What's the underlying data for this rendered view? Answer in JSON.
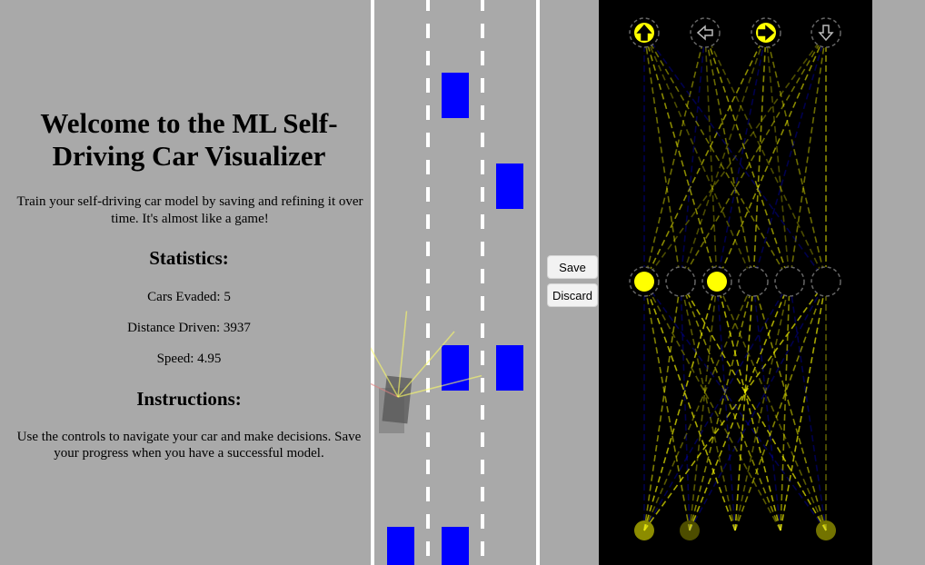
{
  "info": {
    "title": "Welcome to the ML Self-Driving Car Visualizer",
    "intro": "Train your self-driving car model by saving and refining it over time. It's almost like a game!",
    "statistics_heading": "Statistics:",
    "cars_evaded": "Cars Evaded: 5",
    "distance_driven": "Distance Driven: 3937",
    "speed": "Speed: 4.95",
    "instructions_heading": "Instructions:",
    "instructions_text": "Use the controls to navigate your car and make decisions. Save your progress when you have a successful model."
  },
  "controls": {
    "save_label": "Save",
    "discard_label": "Discard"
  },
  "colors": {
    "page_background": "#a9a9a9",
    "road_surface": "#a9a9a9",
    "road_lines": "#ffffff",
    "traffic_car": "#0000ff",
    "player_car": "#555555",
    "sensor_ray": "#ffff66",
    "sensor_hit": "#e08080",
    "network_background": "#000000",
    "node_active": "#ffff00",
    "weight_positive": "#ffff00",
    "weight_negative": "#0000ff"
  },
  "road": {
    "lanes": 3,
    "traffic_cars": [
      {
        "lane": 1,
        "row": 0
      },
      {
        "lane": 2,
        "row": 1
      },
      {
        "lane": 1,
        "row": 2
      },
      {
        "lane": 2,
        "row": 2
      },
      {
        "lane": 0,
        "row": 3
      },
      {
        "lane": 1,
        "row": 3
      }
    ],
    "player": {
      "lane": 0,
      "sensor_rays": 5
    }
  },
  "network": {
    "output_icons": [
      "arrow-up-icon",
      "arrow-left-icon",
      "arrow-right-icon",
      "arrow-down-icon"
    ],
    "output_active": [
      true,
      false,
      true,
      false
    ],
    "hidden_active": [
      1,
      0,
      1,
      0,
      0,
      0
    ],
    "input_active": [
      0.55,
      0.3,
      0,
      0,
      0.45
    ]
  }
}
